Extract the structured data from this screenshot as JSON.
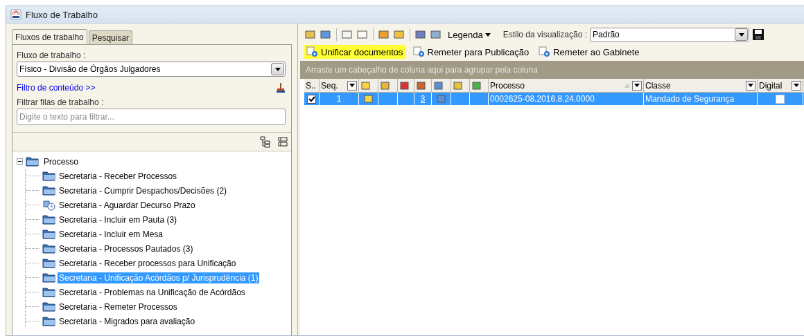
{
  "window": {
    "title": "Fluxo de Trabalho"
  },
  "left_tabs": [
    {
      "label": "Fluxos de trabalho",
      "selected": true
    },
    {
      "label": "Pesquisar",
      "selected": false
    }
  ],
  "workflow_field": {
    "label": "Fluxo de trabalho :",
    "value": "Físico - Divisão de Órgãos Julgadores"
  },
  "content_filter_link": "Filtro de conteúdo >>",
  "queue_filter": {
    "label": "Filtrar filas de trabalho :",
    "placeholder": "Digite o texto para filtrar..."
  },
  "tree": {
    "label": "Processo",
    "expanded": true,
    "children": [
      {
        "label": "Secretaria - Receber Processos",
        "kind": "folder",
        "selected": false
      },
      {
        "label": "Secretaria - Cumprir Despachos/Decisões (2)",
        "kind": "folder",
        "selected": false
      },
      {
        "label": "Secretaria - Aguardar Decurso Prazo",
        "kind": "clock",
        "selected": false
      },
      {
        "label": "Secretaria - Incluir em Pauta (3)",
        "kind": "folder",
        "selected": false
      },
      {
        "label": "Secretaria - Incluir em Mesa",
        "kind": "folder",
        "selected": false
      },
      {
        "label": "Secretaria - Processos Pautados (3)",
        "kind": "folder",
        "selected": false
      },
      {
        "label": "Secretaria - Receber processos para Unificação",
        "kind": "folder",
        "selected": false
      },
      {
        "label": "Secretaria - Unificação Acórdãos p/ Jurisprudência (1)",
        "kind": "folder",
        "selected": true
      },
      {
        "label": "Secretaria - Problemas na Unificação de Acórdãos",
        "kind": "folder",
        "selected": false
      },
      {
        "label": "Secretaria - Remeter Processos",
        "kind": "folder",
        "selected": false
      },
      {
        "label": "Secretaria - Migrados para avaliação",
        "kind": "folder",
        "selected": false
      }
    ]
  },
  "toolbar": {
    "legend": "Legenda",
    "view_style": {
      "label": "Estilo da visualização :",
      "value": "Padrão"
    }
  },
  "actions": [
    {
      "label": "Unificar documentos",
      "highlighted": true
    },
    {
      "label": "Remeter para Publicação",
      "highlighted": false
    },
    {
      "label": "Remeter ao Gabinete",
      "highlighted": false
    }
  ],
  "group_hint": "Arraste um cabeçalho de coluna aqui para agrupar pela coluna",
  "table": {
    "columns": [
      {
        "kind": "text",
        "label": "S..",
        "filter": false
      },
      {
        "kind": "text",
        "label": "Seq.",
        "filter": true
      },
      {
        "kind": "icon"
      },
      {
        "kind": "icon"
      },
      {
        "kind": "icon"
      },
      {
        "kind": "icon"
      },
      {
        "kind": "icon"
      },
      {
        "kind": "icon"
      },
      {
        "kind": "icon"
      },
      {
        "kind": "text",
        "label": "Processo",
        "filter": true,
        "sorted": true
      },
      {
        "kind": "text",
        "label": "Classe",
        "filter": true
      },
      {
        "kind": "text",
        "label": "Digital",
        "filter": true
      }
    ],
    "rows": [
      {
        "selected": true,
        "checked": true,
        "seq": "1",
        "note": true,
        "count": "3",
        "split": true,
        "processo": "0002625-08.2016.8.24.0000",
        "classe": "Mandado de Segurança",
        "digital": false
      }
    ]
  }
}
